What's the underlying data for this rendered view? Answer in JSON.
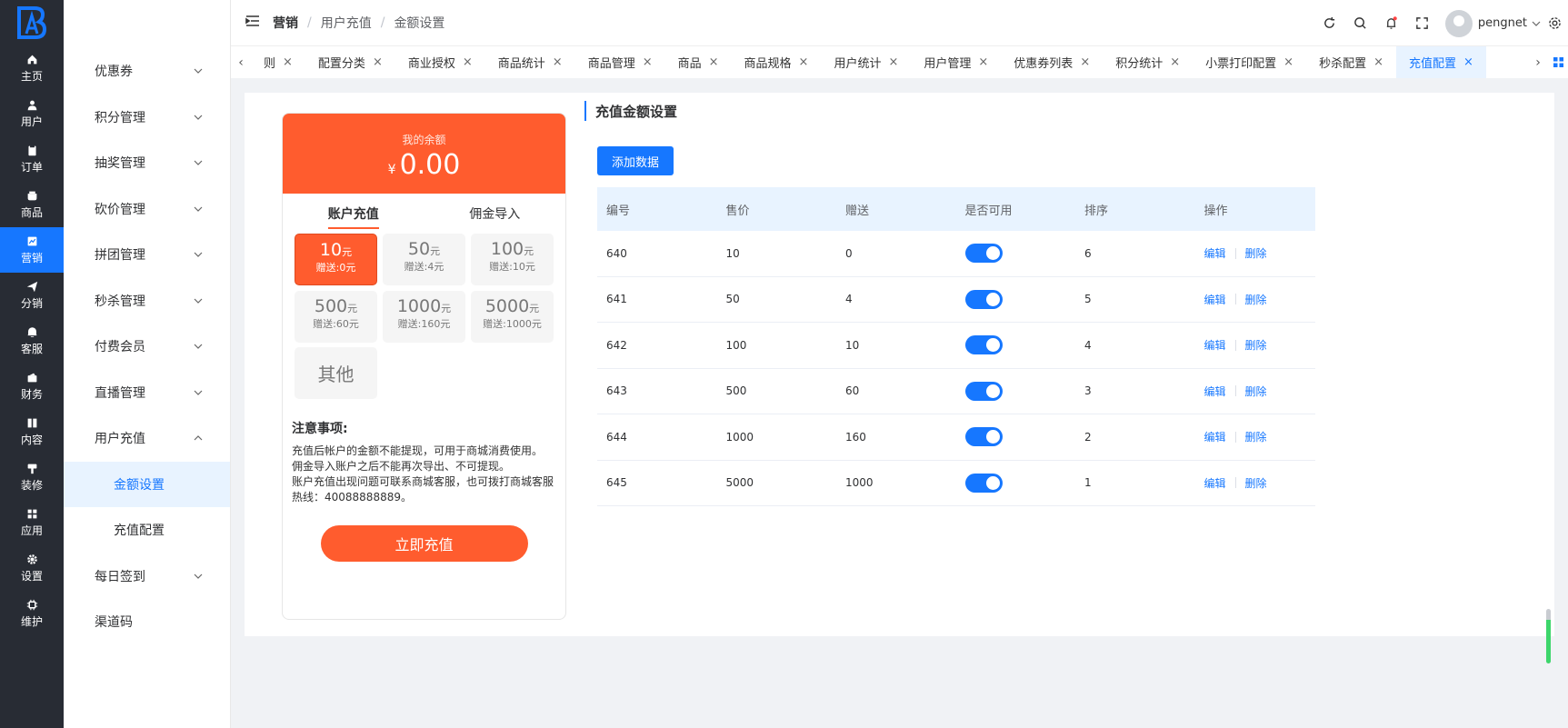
{
  "rail": {
    "items": [
      {
        "label": "主页",
        "icon": "home-icon"
      },
      {
        "label": "用户",
        "icon": "user-icon"
      },
      {
        "label": "订单",
        "icon": "order-icon"
      },
      {
        "label": "商品",
        "icon": "goods-icon"
      },
      {
        "label": "营销",
        "icon": "marketing-icon"
      },
      {
        "label": "分销",
        "icon": "send-icon"
      },
      {
        "label": "客服",
        "icon": "bell-icon"
      },
      {
        "label": "财务",
        "icon": "finance-icon"
      },
      {
        "label": "内容",
        "icon": "content-icon"
      },
      {
        "label": "装修",
        "icon": "brush-icon"
      },
      {
        "label": "应用",
        "icon": "apps-icon"
      },
      {
        "label": "设置",
        "icon": "gear-icon"
      },
      {
        "label": "维护",
        "icon": "chip-icon"
      }
    ]
  },
  "submenu": {
    "items": [
      "优惠券",
      "积分管理",
      "抽奖管理",
      "砍价管理",
      "拼团管理",
      "秒杀管理",
      "付费会员",
      "直播管理",
      "用户充值"
    ],
    "children": [
      "金额设置",
      "充值配置"
    ],
    "after": [
      "每日签到",
      "渠道码"
    ]
  },
  "breadcrumb": {
    "c0": "营销",
    "sep": "/",
    "c1": "用户充值",
    "c2": "金额设置"
  },
  "header": {
    "username": "pengnet"
  },
  "tabs": [
    "则",
    "配置分类",
    "商业授权",
    "商品统计",
    "商品管理",
    "商品",
    "商品规格",
    "用户统计",
    "用户管理",
    "优惠券列表",
    "积分统计",
    "小票打印配置",
    "秒杀配置",
    "充值配置"
  ],
  "preview": {
    "balance_label": "我的余额",
    "currency": "¥",
    "balance": "0.00",
    "tab1": "账户充值",
    "tab2": "佣金导入",
    "unit": "元",
    "options": [
      {
        "amount": "10",
        "gift": "赠送:0元"
      },
      {
        "amount": "50",
        "gift": "赠送:4元"
      },
      {
        "amount": "100",
        "gift": "赠送:10元"
      },
      {
        "amount": "500",
        "gift": "赠送:60元"
      },
      {
        "amount": "1000",
        "gift": "赠送:160元"
      },
      {
        "amount": "5000",
        "gift": "赠送:1000元"
      }
    ],
    "other": "其他",
    "notes_title": "注意事项:",
    "notes": [
      "充值后帐户的金额不能提现，可用于商城消费使用。",
      "佣金导入账户之后不能再次导出、不可提现。",
      "账户充值出现问题可联系商城客服，也可拨打商城客服热线：40088888889。"
    ],
    "pay_button": "立即充值"
  },
  "settings": {
    "title": "充值金额设置",
    "add_button": "添加数据",
    "columns": [
      "编号",
      "售价",
      "赠送",
      "是否可用",
      "排序",
      "操作"
    ],
    "rows": [
      [
        "640",
        "10",
        "0",
        "6"
      ],
      [
        "641",
        "50",
        "4",
        "5"
      ],
      [
        "642",
        "100",
        "10",
        "4"
      ],
      [
        "643",
        "500",
        "60",
        "3"
      ],
      [
        "644",
        "1000",
        "160",
        "2"
      ],
      [
        "645",
        "5000",
        "1000",
        "1"
      ]
    ],
    "edit_label": "编辑",
    "delete_label": "删除"
  }
}
